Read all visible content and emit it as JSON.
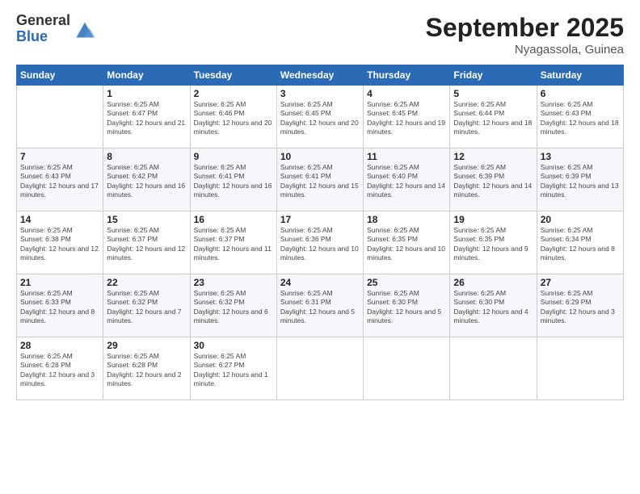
{
  "header": {
    "logo_general": "General",
    "logo_blue": "Blue",
    "month_year": "September 2025",
    "location": "Nyagassola, Guinea"
  },
  "weekdays": [
    "Sunday",
    "Monday",
    "Tuesday",
    "Wednesday",
    "Thursday",
    "Friday",
    "Saturday"
  ],
  "weeks": [
    [
      null,
      {
        "day": "1",
        "sunrise": "6:25 AM",
        "sunset": "6:47 PM",
        "daylight": "12 hours and 21 minutes."
      },
      {
        "day": "2",
        "sunrise": "6:25 AM",
        "sunset": "6:46 PM",
        "daylight": "12 hours and 20 minutes."
      },
      {
        "day": "3",
        "sunrise": "6:25 AM",
        "sunset": "6:45 PM",
        "daylight": "12 hours and 20 minutes."
      },
      {
        "day": "4",
        "sunrise": "6:25 AM",
        "sunset": "6:45 PM",
        "daylight": "12 hours and 19 minutes."
      },
      {
        "day": "5",
        "sunrise": "6:25 AM",
        "sunset": "6:44 PM",
        "daylight": "12 hours and 18 minutes."
      },
      {
        "day": "6",
        "sunrise": "6:25 AM",
        "sunset": "6:43 PM",
        "daylight": "12 hours and 18 minutes."
      }
    ],
    [
      {
        "day": "7",
        "sunrise": "6:25 AM",
        "sunset": "6:43 PM",
        "daylight": "12 hours and 17 minutes."
      },
      {
        "day": "8",
        "sunrise": "6:25 AM",
        "sunset": "6:42 PM",
        "daylight": "12 hours and 16 minutes."
      },
      {
        "day": "9",
        "sunrise": "6:25 AM",
        "sunset": "6:41 PM",
        "daylight": "12 hours and 16 minutes."
      },
      {
        "day": "10",
        "sunrise": "6:25 AM",
        "sunset": "6:41 PM",
        "daylight": "12 hours and 15 minutes."
      },
      {
        "day": "11",
        "sunrise": "6:25 AM",
        "sunset": "6:40 PM",
        "daylight": "12 hours and 14 minutes."
      },
      {
        "day": "12",
        "sunrise": "6:25 AM",
        "sunset": "6:39 PM",
        "daylight": "12 hours and 14 minutes."
      },
      {
        "day": "13",
        "sunrise": "6:25 AM",
        "sunset": "6:39 PM",
        "daylight": "12 hours and 13 minutes."
      }
    ],
    [
      {
        "day": "14",
        "sunrise": "6:25 AM",
        "sunset": "6:38 PM",
        "daylight": "12 hours and 12 minutes."
      },
      {
        "day": "15",
        "sunrise": "6:25 AM",
        "sunset": "6:37 PM",
        "daylight": "12 hours and 12 minutes."
      },
      {
        "day": "16",
        "sunrise": "6:25 AM",
        "sunset": "6:37 PM",
        "daylight": "12 hours and 11 minutes."
      },
      {
        "day": "17",
        "sunrise": "6:25 AM",
        "sunset": "6:36 PM",
        "daylight": "12 hours and 10 minutes."
      },
      {
        "day": "18",
        "sunrise": "6:25 AM",
        "sunset": "6:35 PM",
        "daylight": "12 hours and 10 minutes."
      },
      {
        "day": "19",
        "sunrise": "6:25 AM",
        "sunset": "6:35 PM",
        "daylight": "12 hours and 9 minutes."
      },
      {
        "day": "20",
        "sunrise": "6:25 AM",
        "sunset": "6:34 PM",
        "daylight": "12 hours and 8 minutes."
      }
    ],
    [
      {
        "day": "21",
        "sunrise": "6:25 AM",
        "sunset": "6:33 PM",
        "daylight": "12 hours and 8 minutes."
      },
      {
        "day": "22",
        "sunrise": "6:25 AM",
        "sunset": "6:32 PM",
        "daylight": "12 hours and 7 minutes."
      },
      {
        "day": "23",
        "sunrise": "6:25 AM",
        "sunset": "6:32 PM",
        "daylight": "12 hours and 6 minutes."
      },
      {
        "day": "24",
        "sunrise": "6:25 AM",
        "sunset": "6:31 PM",
        "daylight": "12 hours and 5 minutes."
      },
      {
        "day": "25",
        "sunrise": "6:25 AM",
        "sunset": "6:30 PM",
        "daylight": "12 hours and 5 minutes."
      },
      {
        "day": "26",
        "sunrise": "6:25 AM",
        "sunset": "6:30 PM",
        "daylight": "12 hours and 4 minutes."
      },
      {
        "day": "27",
        "sunrise": "6:25 AM",
        "sunset": "6:29 PM",
        "daylight": "12 hours and 3 minutes."
      }
    ],
    [
      {
        "day": "28",
        "sunrise": "6:25 AM",
        "sunset": "6:28 PM",
        "daylight": "12 hours and 3 minutes."
      },
      {
        "day": "29",
        "sunrise": "6:25 AM",
        "sunset": "6:28 PM",
        "daylight": "12 hours and 2 minutes."
      },
      {
        "day": "30",
        "sunrise": "6:25 AM",
        "sunset": "6:27 PM",
        "daylight": "12 hours and 1 minute."
      },
      null,
      null,
      null,
      null
    ]
  ],
  "labels": {
    "sunrise_prefix": "Sunrise: ",
    "sunset_prefix": "Sunset: ",
    "daylight_prefix": "Daylight: "
  }
}
